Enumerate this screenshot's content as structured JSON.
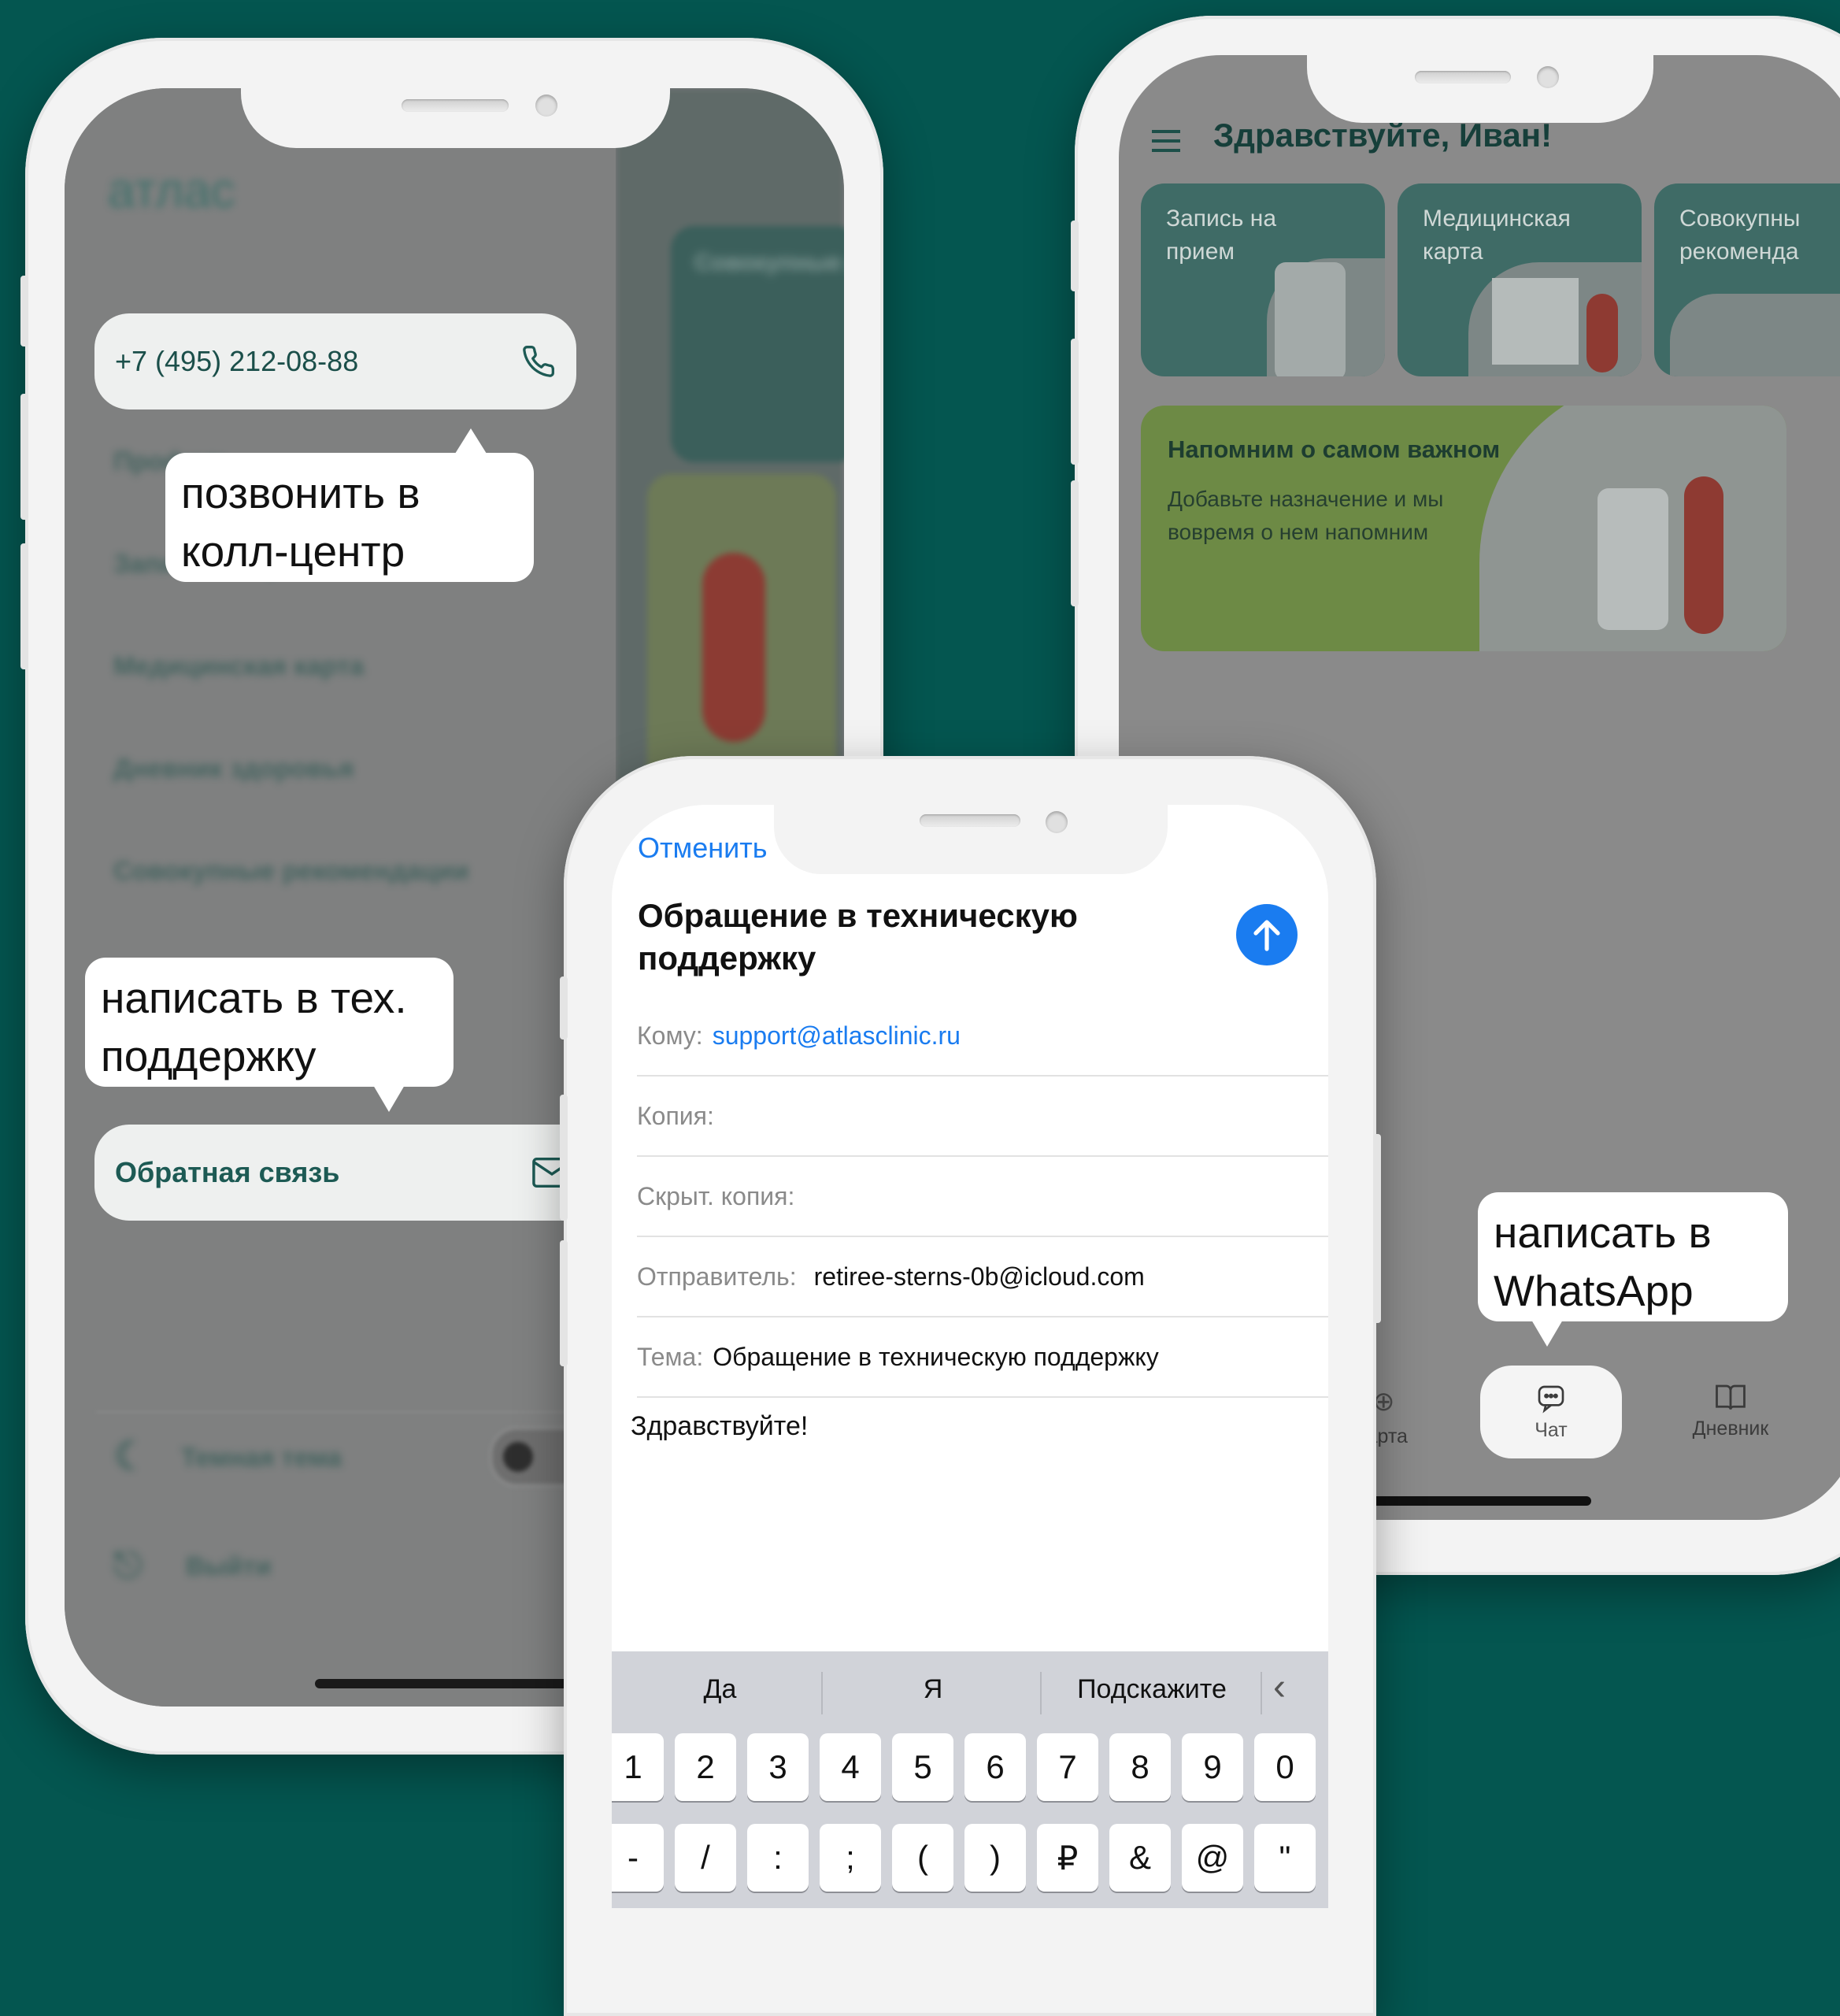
{
  "left_phone": {
    "logo": "атлас",
    "phone_number": "+7 (495) 212-08-88",
    "phone_icon": "phone-icon",
    "menu_items": [
      "Профиль",
      "Запись на прием",
      "Медицинская карта",
      "Дневник здоровья",
      "Совокупные рекомендации"
    ],
    "feedback_label": "Обратная связь",
    "feedback_icon": "mail-icon",
    "dark_theme_label": "Темная тема",
    "logout_label": "Выйти",
    "behind_card_title": "Совокупные рекомендации"
  },
  "right_phone": {
    "greeting": "Здравствуйте, Иван!",
    "tiles": [
      "Запись на прием",
      "Медицинская карта",
      "Совокупны рекоменда"
    ],
    "reminder": {
      "title": "Напомним о самом важном",
      "text": "Добавьте назначение и мы вовремя о нем напомним"
    },
    "tabbar": [
      {
        "label": "Карта",
        "icon": "card-icon"
      },
      {
        "label": "Чат",
        "icon": "chat-icon"
      },
      {
        "label": "Дневник",
        "icon": "book-icon"
      }
    ]
  },
  "mail": {
    "cancel": "Отменить",
    "title": "Обращение в техническую поддержку",
    "to_label": "Кому:",
    "to_value": "support@atlasclinic.ru",
    "cc_label": "Копия:",
    "bcc_label": "Скрыт. копия:",
    "from_label": "Отправитель:",
    "from_value": "retiree-sterns-0b@icloud.com",
    "subject_label": "Тема:",
    "subject_value": "Обращение в техническую поддержку",
    "body": "Здравствуйте!",
    "accent_color": "#1a7cf0"
  },
  "keyboard": {
    "suggestions": [
      "Да",
      "Я",
      "Подскажите"
    ],
    "row1": [
      "1",
      "2",
      "3",
      "4",
      "5",
      "6",
      "7",
      "8",
      "9",
      "0"
    ],
    "row2": [
      "-",
      "/",
      ":",
      ";",
      "(",
      ")",
      "₽",
      "&",
      "@",
      "\""
    ]
  },
  "callouts": {
    "call": "позвонить в колл-центр",
    "support": "написать в тех. поддержку",
    "whatsapp": "написать в WhatsApp"
  }
}
